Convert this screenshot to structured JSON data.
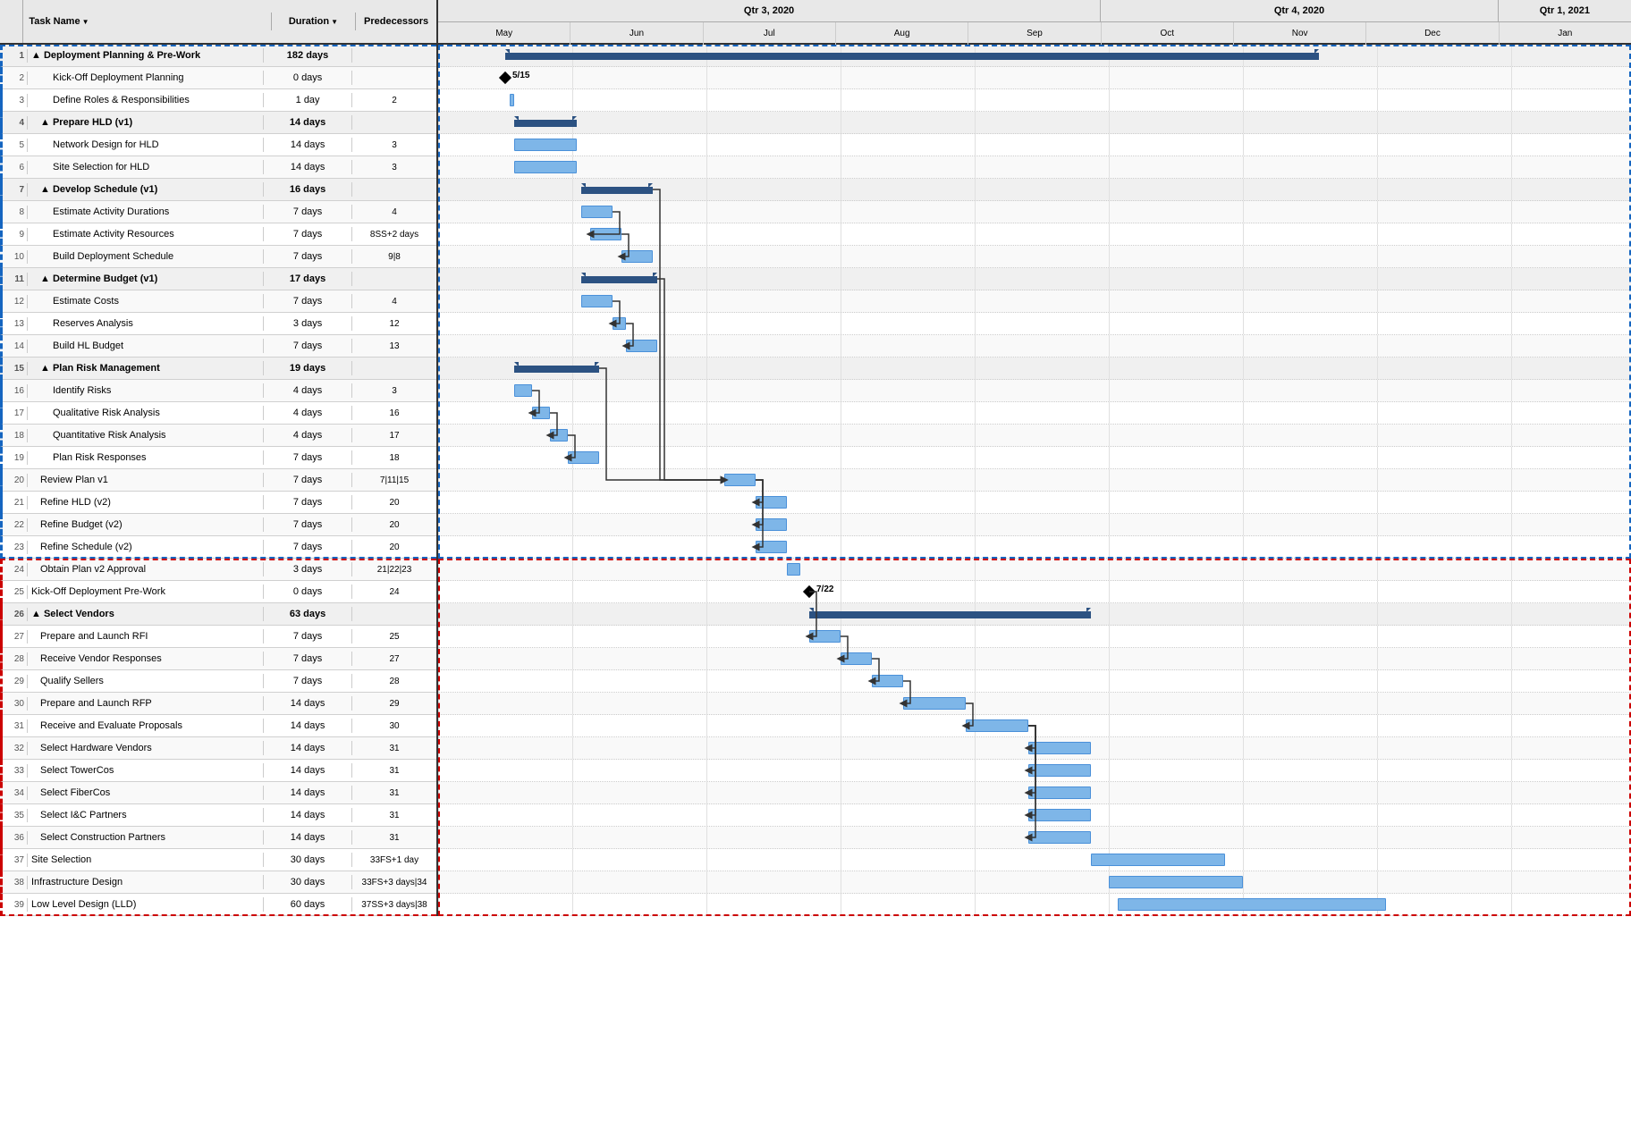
{
  "header": {
    "col_task": "Task Name",
    "col_duration": "Duration",
    "col_pred": "Predecessors",
    "sort_icon": "▼"
  },
  "quarters": [
    {
      "label": "Qtr 3, 2020",
      "months": [
        "May",
        "Jun",
        "Jul",
        "Aug",
        "Sep"
      ]
    },
    {
      "label": "Qtr 4, 2020",
      "months": [
        "Oct",
        "Nov",
        "Dec"
      ]
    },
    {
      "label": "Qtr 1, 2021",
      "months": [
        "Jan"
      ]
    }
  ],
  "tasks": [
    {
      "id": 1,
      "num": "1",
      "name": "▲ Deployment Planning & Pre-Work",
      "indent": 0,
      "summary": true,
      "duration": "182 days",
      "pred": "",
      "section": "blue"
    },
    {
      "id": 2,
      "num": "2",
      "name": "Kick-Off Deployment Planning",
      "indent": 2,
      "summary": false,
      "duration": "0 days",
      "pred": "",
      "section": "blue"
    },
    {
      "id": 3,
      "num": "3",
      "name": "Define Roles & Responsibilities",
      "indent": 2,
      "summary": false,
      "duration": "1 day",
      "pred": "2",
      "section": "blue"
    },
    {
      "id": 4,
      "num": "4",
      "name": "▲ Prepare HLD (v1)",
      "indent": 1,
      "summary": true,
      "duration": "14 days",
      "pred": "",
      "section": "blue"
    },
    {
      "id": 5,
      "num": "5",
      "name": "Network Design for HLD",
      "indent": 2,
      "summary": false,
      "duration": "14 days",
      "pred": "3",
      "section": "blue"
    },
    {
      "id": 6,
      "num": "6",
      "name": "Site Selection for HLD",
      "indent": 2,
      "summary": false,
      "duration": "14 days",
      "pred": "3",
      "section": "blue"
    },
    {
      "id": 7,
      "num": "7",
      "name": "▲ Develop Schedule (v1)",
      "indent": 1,
      "summary": true,
      "duration": "16 days",
      "pred": "",
      "section": "blue"
    },
    {
      "id": 8,
      "num": "8",
      "name": "Estimate Activity Durations",
      "indent": 2,
      "summary": false,
      "duration": "7 days",
      "pred": "4",
      "section": "blue"
    },
    {
      "id": 9,
      "num": "9",
      "name": "Estimate Activity Resources",
      "indent": 2,
      "summary": false,
      "duration": "7 days",
      "pred": "8SS+2 days",
      "section": "blue"
    },
    {
      "id": 10,
      "num": "10",
      "name": "Build Deployment Schedule",
      "indent": 2,
      "summary": false,
      "duration": "7 days",
      "pred": "9|8",
      "section": "blue"
    },
    {
      "id": 11,
      "num": "11",
      "name": "▲ Determine Budget (v1)",
      "indent": 1,
      "summary": true,
      "duration": "17 days",
      "pred": "",
      "section": "blue"
    },
    {
      "id": 12,
      "num": "12",
      "name": "Estimate Costs",
      "indent": 2,
      "summary": false,
      "duration": "7 days",
      "pred": "4",
      "section": "blue"
    },
    {
      "id": 13,
      "num": "13",
      "name": "Reserves Analysis",
      "indent": 2,
      "summary": false,
      "duration": "3 days",
      "pred": "12",
      "section": "blue"
    },
    {
      "id": 14,
      "num": "14",
      "name": "Build HL Budget",
      "indent": 2,
      "summary": false,
      "duration": "7 days",
      "pred": "13",
      "section": "blue"
    },
    {
      "id": 15,
      "num": "15",
      "name": "▲ Plan Risk Management",
      "indent": 1,
      "summary": true,
      "duration": "19 days",
      "pred": "",
      "section": "blue"
    },
    {
      "id": 16,
      "num": "16",
      "name": "Identify Risks",
      "indent": 2,
      "summary": false,
      "duration": "4 days",
      "pred": "3",
      "section": "blue"
    },
    {
      "id": 17,
      "num": "17",
      "name": "Qualitative Risk Analysis",
      "indent": 2,
      "summary": false,
      "duration": "4 days",
      "pred": "16",
      "section": "blue"
    },
    {
      "id": 18,
      "num": "18",
      "name": "Quantitative Risk Analysis",
      "indent": 2,
      "summary": false,
      "duration": "4 days",
      "pred": "17",
      "section": "blue"
    },
    {
      "id": 19,
      "num": "19",
      "name": "Plan Risk Responses",
      "indent": 2,
      "summary": false,
      "duration": "7 days",
      "pred": "18",
      "section": "blue"
    },
    {
      "id": 20,
      "num": "20",
      "name": "Review Plan v1",
      "indent": 1,
      "summary": false,
      "duration": "7 days",
      "pred": "7|11|15",
      "section": "blue"
    },
    {
      "id": 21,
      "num": "21",
      "name": "Refine HLD (v2)",
      "indent": 1,
      "summary": false,
      "duration": "7 days",
      "pred": "20",
      "section": "blue"
    },
    {
      "id": 22,
      "num": "22",
      "name": "Refine Budget (v2)",
      "indent": 1,
      "summary": false,
      "duration": "7 days",
      "pred": "20",
      "section": "blue"
    },
    {
      "id": 23,
      "num": "23",
      "name": "Refine Schedule (v2)",
      "indent": 1,
      "summary": false,
      "duration": "7 days",
      "pred": "20",
      "section": "blue"
    },
    {
      "id": 24,
      "num": "24",
      "name": "Obtain Plan v2 Approval",
      "indent": 1,
      "summary": false,
      "duration": "3 days",
      "pred": "21|22|23",
      "section": "red"
    },
    {
      "id": 25,
      "num": "25",
      "name": "Kick-Off Deployment Pre-Work",
      "indent": 0,
      "summary": false,
      "duration": "0 days",
      "pred": "24",
      "section": "red"
    },
    {
      "id": 26,
      "num": "26",
      "name": "▲ Select Vendors",
      "indent": 0,
      "summary": true,
      "duration": "63 days",
      "pred": "",
      "section": "red"
    },
    {
      "id": 27,
      "num": "27",
      "name": "Prepare and Launch RFI",
      "indent": 1,
      "summary": false,
      "duration": "7 days",
      "pred": "25",
      "section": "red"
    },
    {
      "id": 28,
      "num": "28",
      "name": "Receive Vendor Responses",
      "indent": 1,
      "summary": false,
      "duration": "7 days",
      "pred": "27",
      "section": "red"
    },
    {
      "id": 29,
      "num": "29",
      "name": "Qualify Sellers",
      "indent": 1,
      "summary": false,
      "duration": "7 days",
      "pred": "28",
      "section": "red"
    },
    {
      "id": 30,
      "num": "30",
      "name": "Prepare and Launch RFP",
      "indent": 1,
      "summary": false,
      "duration": "14 days",
      "pred": "29",
      "section": "red"
    },
    {
      "id": 31,
      "num": "31",
      "name": "Receive and Evaluate Proposals",
      "indent": 1,
      "summary": false,
      "duration": "14 days",
      "pred": "30",
      "section": "red"
    },
    {
      "id": 32,
      "num": "32",
      "name": "Select Hardware Vendors",
      "indent": 1,
      "summary": false,
      "duration": "14 days",
      "pred": "31",
      "section": "red"
    },
    {
      "id": 33,
      "num": "33",
      "name": "Select TowerCos",
      "indent": 1,
      "summary": false,
      "duration": "14 days",
      "pred": "31",
      "section": "red"
    },
    {
      "id": 34,
      "num": "34",
      "name": "Select FiberCos",
      "indent": 1,
      "summary": false,
      "duration": "14 days",
      "pred": "31",
      "section": "red"
    },
    {
      "id": 35,
      "num": "35",
      "name": "Select I&C Partners",
      "indent": 1,
      "summary": false,
      "duration": "14 days",
      "pred": "31",
      "section": "red"
    },
    {
      "id": 36,
      "num": "36",
      "name": "Select Construction Partners",
      "indent": 1,
      "summary": false,
      "duration": "14 days",
      "pred": "31",
      "section": "red"
    },
    {
      "id": 37,
      "num": "37",
      "name": "Site Selection",
      "indent": 0,
      "summary": false,
      "duration": "30 days",
      "pred": "33FS+1 day",
      "section": "red"
    },
    {
      "id": 38,
      "num": "38",
      "name": "Infrastructure Design",
      "indent": 0,
      "summary": false,
      "duration": "30 days",
      "pred": "33FS+3 days|34",
      "section": "red"
    },
    {
      "id": 39,
      "num": "39",
      "name": "Low Level Design (LLD)",
      "indent": 0,
      "summary": false,
      "duration": "60 days",
      "pred": "37SS+3 days|38",
      "section": "red"
    }
  ],
  "colors": {
    "blue_border": "#1565c0",
    "red_border": "#cc0000",
    "bar_fill": "#7eb6e8",
    "bar_stroke": "#4a90d9",
    "summary_bar": "#2c5282",
    "milestone": "#000000",
    "header_bg": "#e8e8e8",
    "grid_line": "#d0d0d0"
  }
}
